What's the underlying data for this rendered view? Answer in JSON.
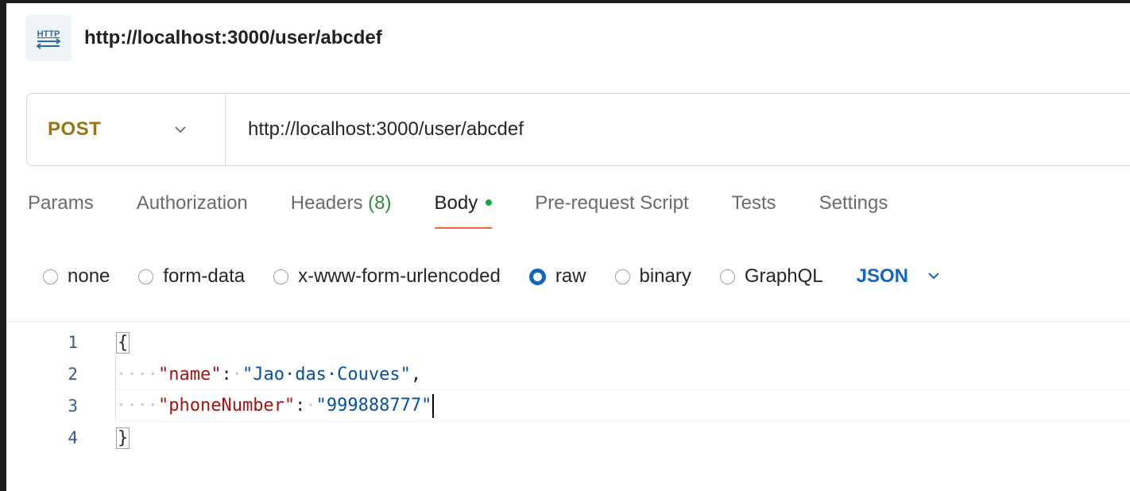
{
  "titlebar": {
    "icon": "http-icon",
    "icon_text": "HTTP",
    "title": "http://localhost:3000/user/abcdef"
  },
  "request": {
    "method": "POST",
    "url": "http://localhost:3000/user/abcdef"
  },
  "tabs": [
    {
      "label": "Params"
    },
    {
      "label": "Authorization"
    },
    {
      "label": "Headers",
      "count": "(8)"
    },
    {
      "label": "Body",
      "active": true,
      "dot": true
    },
    {
      "label": "Pre-request Script"
    },
    {
      "label": "Tests"
    },
    {
      "label": "Settings"
    }
  ],
  "body_types": {
    "options": [
      "none",
      "form-data",
      "x-www-form-urlencoded",
      "raw",
      "binary",
      "GraphQL"
    ],
    "selected": "raw",
    "format": "JSON"
  },
  "editor": {
    "line_numbers": [
      "1",
      "2",
      "3",
      "4"
    ],
    "open_brace": "{",
    "close_brace": "}",
    "indent": "····",
    "line2_key": "\"name\"",
    "line2_sep": ":",
    "line2_dot": "·",
    "line2_value": "\"Jao·das·Couves\"",
    "line2_comma": ",",
    "line3_key": "\"phoneNumber\"",
    "line3_sep": ":",
    "line3_dot": "·",
    "line3_value": "\"999888777\""
  },
  "colors": {
    "method": "#9a7313",
    "accent_tab": "#ef6c3a",
    "dot": "#1ea34a",
    "format": "#1565c0",
    "json_key": "#a31515",
    "json_string": "#0451a5"
  }
}
